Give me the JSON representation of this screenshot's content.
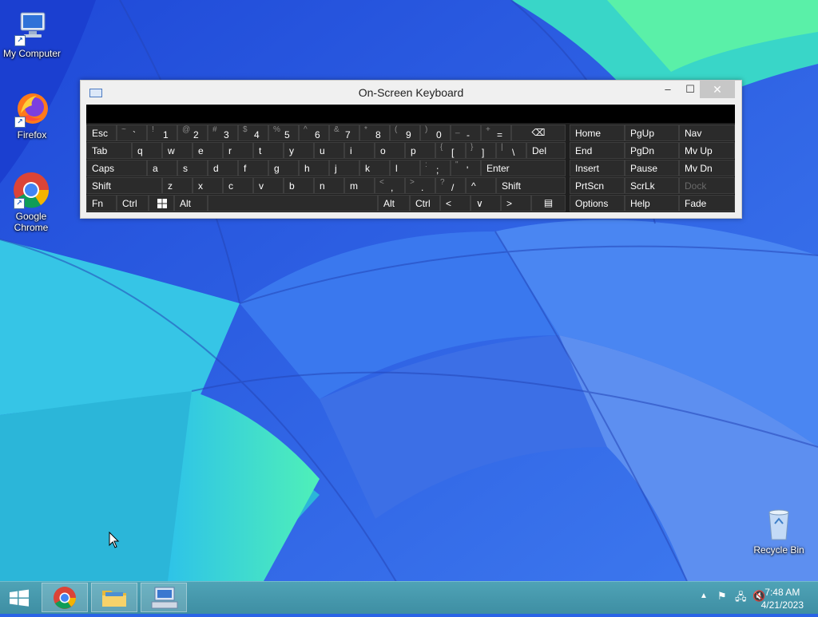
{
  "desktop": {
    "icons": [
      {
        "label": "My Computer"
      },
      {
        "label": "Firefox"
      },
      {
        "label": "Google Chrome"
      },
      {
        "label": "Recycle Bin"
      }
    ]
  },
  "osk": {
    "title": "On-Screen Keyboard",
    "minimize_glyph": "–",
    "maximize_glyph": "☐",
    "close_glyph": "✕",
    "rows": [
      [
        {
          "label": "Esc"
        },
        {
          "shift": "~",
          "main": "`"
        },
        {
          "shift": "!",
          "main": "1"
        },
        {
          "shift": "@",
          "main": "2"
        },
        {
          "shift": "#",
          "main": "3"
        },
        {
          "shift": "$",
          "main": "4"
        },
        {
          "shift": "%",
          "main": "5"
        },
        {
          "shift": "^",
          "main": "6"
        },
        {
          "shift": "&",
          "main": "7"
        },
        {
          "shift": "*",
          "main": "8"
        },
        {
          "shift": "(",
          "main": "9"
        },
        {
          "shift": ")",
          "main": "0"
        },
        {
          "shift": "_",
          "main": "-"
        },
        {
          "shift": "+",
          "main": "="
        },
        {
          "label": "⌫",
          "icon": "backspace-icon"
        }
      ],
      [
        {
          "label": "Tab"
        },
        {
          "label": "q"
        },
        {
          "label": "w"
        },
        {
          "label": "e"
        },
        {
          "label": "r"
        },
        {
          "label": "t"
        },
        {
          "label": "y"
        },
        {
          "label": "u"
        },
        {
          "label": "i"
        },
        {
          "label": "o"
        },
        {
          "label": "p"
        },
        {
          "shift": "{",
          "main": "["
        },
        {
          "shift": "}",
          "main": "]"
        },
        {
          "shift": "|",
          "main": "\\"
        },
        {
          "label": "Del"
        }
      ],
      [
        {
          "label": "Caps"
        },
        {
          "label": "a"
        },
        {
          "label": "s"
        },
        {
          "label": "d"
        },
        {
          "label": "f"
        },
        {
          "label": "g"
        },
        {
          "label": "h"
        },
        {
          "label": "j"
        },
        {
          "label": "k"
        },
        {
          "label": "l"
        },
        {
          "shift": ":",
          "main": ";"
        },
        {
          "shift": "\"",
          "main": "'"
        },
        {
          "label": "Enter"
        }
      ],
      [
        {
          "label": "Shift"
        },
        {
          "label": "z"
        },
        {
          "label": "x"
        },
        {
          "label": "c"
        },
        {
          "label": "v"
        },
        {
          "label": "b"
        },
        {
          "label": "n"
        },
        {
          "label": "m"
        },
        {
          "shift": "<",
          "main": ","
        },
        {
          "shift": ">",
          "main": "."
        },
        {
          "shift": "?",
          "main": "/"
        },
        {
          "label": "^"
        },
        {
          "label": "Shift"
        }
      ],
      [
        {
          "label": "Fn"
        },
        {
          "label": "Ctrl"
        },
        {
          "label": "",
          "icon": "windows-logo-icon"
        },
        {
          "label": "Alt"
        },
        {
          "label": ""
        },
        {
          "label": "Alt"
        },
        {
          "label": "Ctrl"
        },
        {
          "label": "<"
        },
        {
          "label": "∨"
        },
        {
          "label": ">"
        },
        {
          "label": "▤",
          "icon": "menu-key-icon"
        }
      ]
    ],
    "nav_keys": [
      [
        "Home",
        "PgUp",
        "Nav"
      ],
      [
        "End",
        "PgDn",
        "Mv Up"
      ],
      [
        "Insert",
        "Pause",
        "Mv Dn"
      ],
      [
        "PrtScn",
        "ScrLk",
        "Dock"
      ],
      [
        "Options",
        "Help",
        "Fade"
      ]
    ]
  },
  "taskbar": {
    "apps": [
      {
        "name": "Google Chrome",
        "icon": "chrome-icon"
      },
      {
        "name": "File Explorer",
        "icon": "folder-icon"
      },
      {
        "name": "On-Screen Keyboard",
        "icon": "keyboard-icon"
      }
    ],
    "clock": {
      "time": "7:48 AM",
      "date": "4/21/2023"
    }
  },
  "colors": {
    "wallpaper_blue": "#2a63e6",
    "wallpaper_green": "#3fe0b0",
    "taskbar": "#4596ab",
    "key_bg": "#2b2b2b"
  }
}
